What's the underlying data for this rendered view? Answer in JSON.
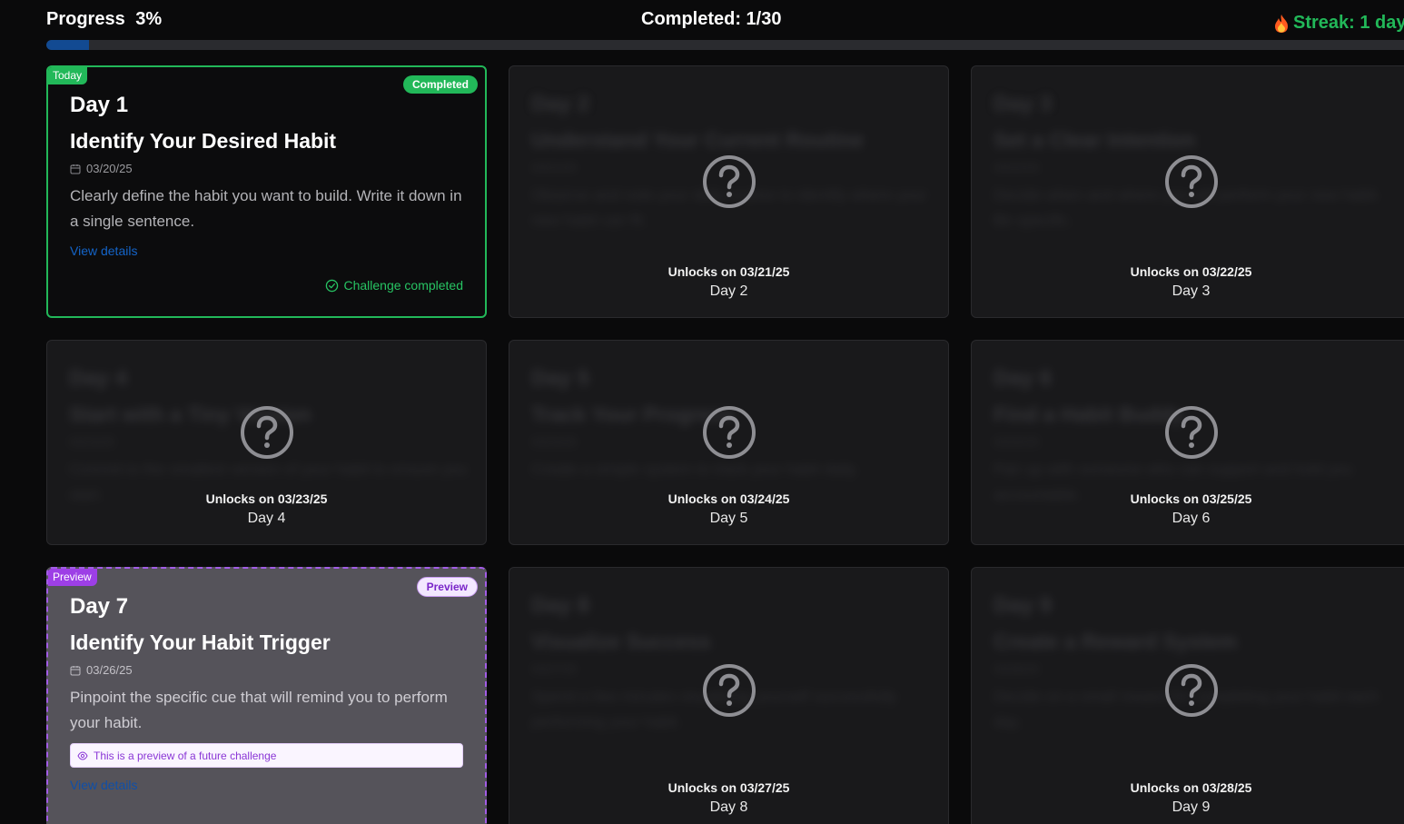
{
  "header": {
    "progress_label": "Progress",
    "progress_value": "3%",
    "progress_fraction": 0.03,
    "completed_label": "Completed: 1/30",
    "streak_label": "Streak: 1 day"
  },
  "colors": {
    "accent_green": "#22b859",
    "accent_purple": "#9d3fe6",
    "progress_blue": "#124a92",
    "link_blue": "#1464c8"
  },
  "cards": [
    {
      "state": "today",
      "corner_tag": "Today",
      "badge": "Completed",
      "day": "Day 1",
      "title": "Identify Your Desired Habit",
      "date": "03/20/25",
      "description": "Clearly define the habit you want to build. Write it down in a single sentence.",
      "link": "View details",
      "status": "Challenge completed"
    },
    {
      "state": "locked",
      "day": "Day 2",
      "title": "Understand Your Current Routine",
      "date": "03/21/25",
      "description": "Observe and note your daily routine to identify where your new habit can fit.",
      "unlock_text": "Unlocks on 03/21/25"
    },
    {
      "state": "locked",
      "day": "Day 3",
      "title": "Set a Clear Intention",
      "date": "03/22/25",
      "description": "Decide when and where you will perform your new habit. Be specific.",
      "unlock_text": "Unlocks on 03/22/25"
    },
    {
      "state": "locked",
      "day": "Day 4",
      "title": "Start with a Tiny Version",
      "date": "03/23/25",
      "description": "Commit to the smallest version of your habit to ensure you start.",
      "unlock_text": "Unlocks on 03/23/25"
    },
    {
      "state": "locked",
      "day": "Day 5",
      "title": "Track Your Progress",
      "date": "03/24/25",
      "description": "Create a simple system to track your habit daily.",
      "unlock_text": "Unlocks on 03/24/25"
    },
    {
      "state": "locked",
      "day": "Day 6",
      "title": "Find a Habit Buddy",
      "date": "03/25/25",
      "description": "Pair up with someone who can support and hold you accountable.",
      "unlock_text": "Unlocks on 03/25/25"
    },
    {
      "state": "preview",
      "corner_tag": "Preview",
      "badge": "Preview",
      "day": "Day 7",
      "title": "Identify Your Habit Trigger",
      "date": "03/26/25",
      "description": "Pinpoint the specific cue that will remind you to perform your habit.",
      "note": "This is a preview of a future challenge",
      "link": "View details"
    },
    {
      "state": "locked",
      "day": "Day 8",
      "title": "Visualize Success",
      "date": "03/27/25",
      "description": "Spend a few minutes visualizing yourself successfully performing your habit.",
      "unlock_text": "Unlocks on 03/27/25"
    },
    {
      "state": "locked",
      "day": "Day 9",
      "title": "Create a Reward System",
      "date": "03/28/25",
      "description": "Decide on a small reward for completing your habit each day.",
      "unlock_text": "Unlocks on 03/28/25"
    }
  ]
}
